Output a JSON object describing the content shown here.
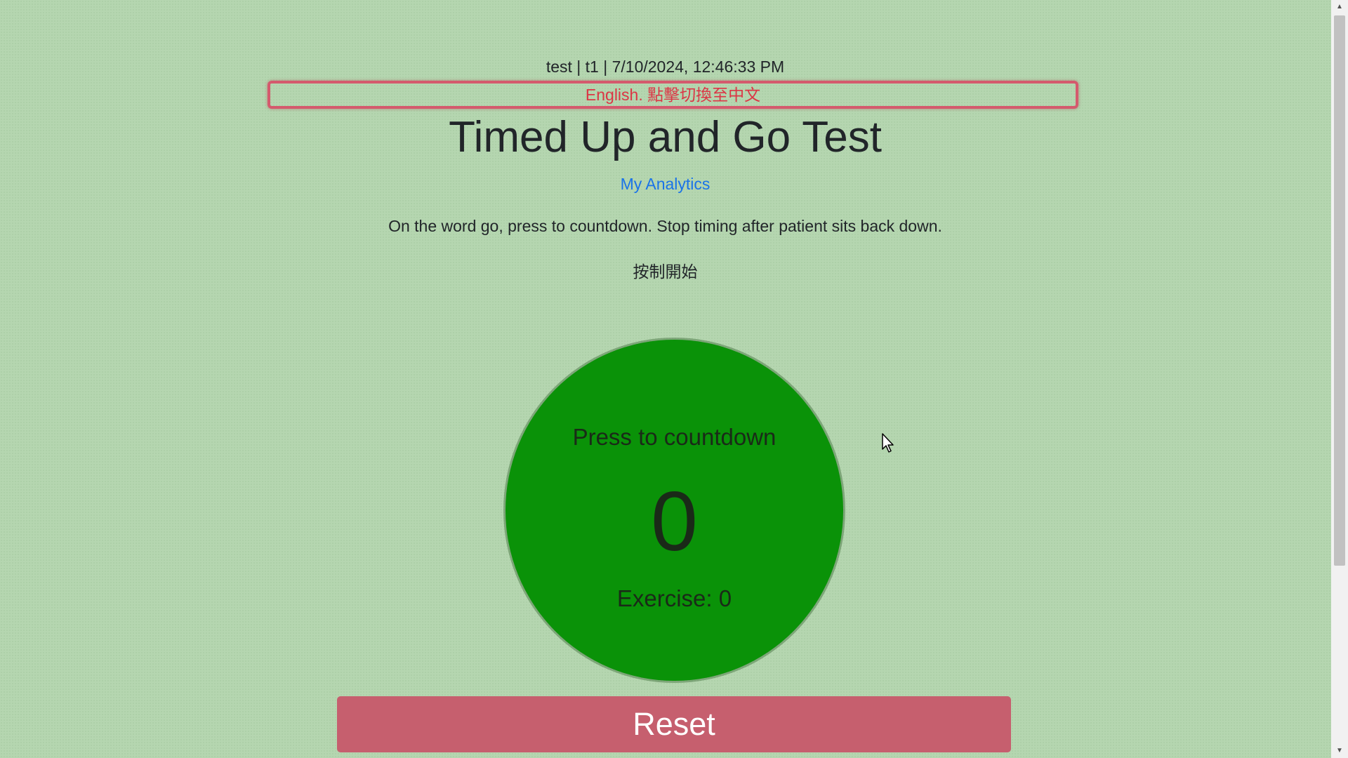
{
  "header": {
    "user_info": "test | t1 | 7/10/2024, 12:46:33 PM",
    "language_toggle": "English. 點擊切換至中文"
  },
  "main": {
    "title": "Timed Up and Go Test",
    "analytics_link": "My Analytics",
    "instructions": "On the word go, press to countdown. Stop timing after patient sits back down.",
    "instructions_zh": "按制開始"
  },
  "timer": {
    "label": "Press to countdown",
    "value": "0",
    "exercise": "Exercise: 0",
    "color": "#0a9208"
  },
  "actions": {
    "reset_label": "Reset",
    "reset_color": "#c65f6e"
  },
  "scrollbar": {
    "up_arrow_icon": "triangle-up-icon",
    "down_arrow_icon": "triangle-down-icon"
  },
  "colors": {
    "background": "#b5d6b0",
    "link": "#1a73e8",
    "toggle_text": "#dc3545"
  }
}
